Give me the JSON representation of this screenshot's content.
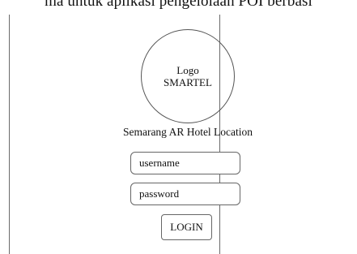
{
  "caption": "ma untuk aplikasi pengelolaan POI berbasi",
  "logo": {
    "line1": "Logo",
    "line2": "SMARTEL"
  },
  "subtitle": "Semarang AR Hotel Location",
  "form": {
    "username_placeholder": "username",
    "password_placeholder": "password",
    "login_label": "LOGIN"
  }
}
